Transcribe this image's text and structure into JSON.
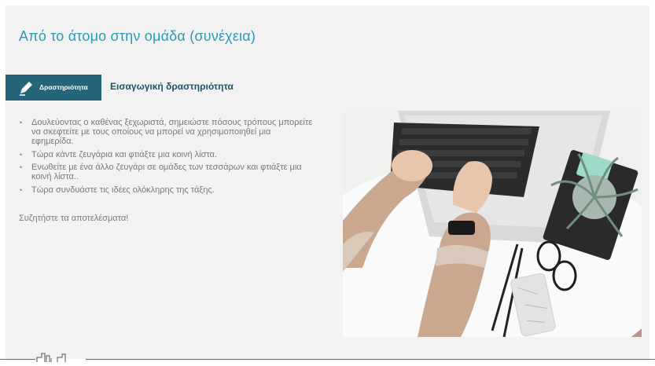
{
  "slide": {
    "title": "Από το άτομο στην ομάδα (συνέχεια)",
    "banner_label": "Δραστηριότητα",
    "section_title": "Εισαγωγική δραστηριότητα",
    "bullets": [
      "Δουλεύοντας ο καθένας ξεχωριστά, σημειώστε πόσους τρόπους μπορείτε να σκεφτείτε με τους οποίους να μπορεί να χρησιμοποιηθεί μια εφημερίδα.",
      "Τώρα κάντε ζευγάρια και φτιάξτε μια κοινή λίστα.",
      "Ενωθείτε με ένα άλλο ζευγάρι σε ομάδες των τεσσάρων και φτιάξτε μια κοινή λίστα..",
      "Τώρα συνδυάστε τις ιδέες ολόκληρης της τάξης."
    ],
    "closing": "Συζητήστε τα αποτελέσματα!"
  },
  "icons": {
    "banner_icon": "pencil-icon",
    "footer_logo": "logo-icon"
  },
  "colors": {
    "title": "#2a9bb7",
    "banner_bg": "#24657a",
    "section_title": "#1f5466",
    "body_text": "#7a7a7a",
    "slide_bg": "#f2f2f2"
  }
}
